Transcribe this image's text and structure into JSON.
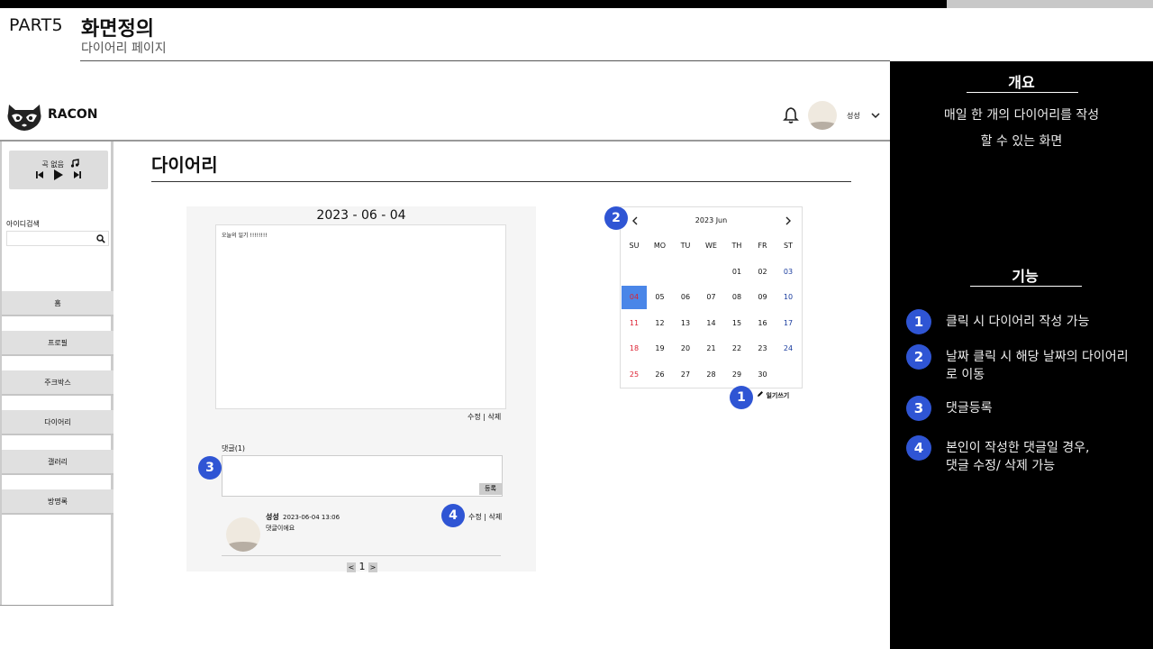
{
  "doc": {
    "part": "PART5",
    "title": "화면정의",
    "subtitle": "다이어리 페이지"
  },
  "right_panel": {
    "overview_heading": "개요",
    "overview_line1": "매일 한 개의 다이어리를 작성",
    "overview_line2": "할 수 있는 화면",
    "features_heading": "기능",
    "features": [
      {
        "num": "1",
        "text": "클릭 시 다이어리 작성 가능"
      },
      {
        "num": "2",
        "text": "날짜 클릭 시 해당 날짜의 다이어리로 이동"
      },
      {
        "num": "3",
        "text": "댓글등록"
      },
      {
        "num": "4",
        "text": "본인이 작성한 댓글일 경우, 댓글 수정/ 삭제 가능"
      }
    ]
  },
  "app": {
    "logo": "RACON",
    "user_name": "성성",
    "player_label": "곡 없음",
    "search_label": "아이디검색",
    "menu": [
      "홈",
      "프로필",
      "주크박스",
      "다이어리",
      "갤러리",
      "방명록"
    ]
  },
  "content": {
    "title": "다이어리",
    "diary_date": "2023 - 06 - 04",
    "diary_text": "오늘의 일기 !!!!!!!!",
    "diary_actions": "수정 | 삭제",
    "comment_label": "댓글(1)",
    "comment_button": "등록",
    "comment": {
      "author": "성성",
      "time": "2023-06-04 13:06",
      "text": "댓글이에요",
      "actions": "수정 | 삭제"
    },
    "pager": {
      "prev": "<",
      "page": "1",
      "next": ">"
    }
  },
  "calendar": {
    "month_label": "2023 Jun",
    "weekdays": [
      "SU",
      "MO",
      "TU",
      "WE",
      "TH",
      "FR",
      "ST"
    ],
    "first_weekday_index": 4,
    "days": [
      "01",
      "02",
      "03",
      "04",
      "05",
      "06",
      "07",
      "08",
      "09",
      "10",
      "11",
      "12",
      "13",
      "14",
      "15",
      "16",
      "17",
      "18",
      "19",
      "20",
      "21",
      "22",
      "23",
      "24",
      "25",
      "26",
      "27",
      "28",
      "29",
      "30"
    ],
    "selected_day": "04",
    "selected_color": "#4a86e8",
    "sunday_color": "#d23333",
    "saturday_color": "#1a3c9e",
    "write_label": "일기쓰기"
  },
  "badges": {
    "b1": "1",
    "b2": "2",
    "b3": "3",
    "b4": "4"
  },
  "colors": {
    "badge": "#2f55d4",
    "panel": "#000000"
  }
}
